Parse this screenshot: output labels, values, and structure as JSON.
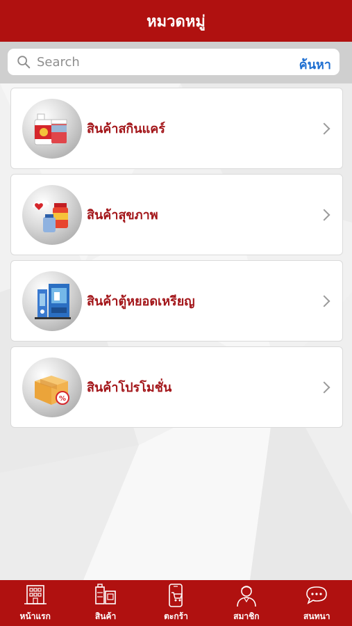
{
  "header": {
    "title": "หมวดหมู่"
  },
  "search": {
    "placeholder": "Search",
    "button_label": "ค้นหา"
  },
  "categories": [
    {
      "label": "สินค้าสกินแคร์",
      "icon": "skincare-icon"
    },
    {
      "label": "สินค้าสุขภาพ",
      "icon": "health-icon"
    },
    {
      "label": "สินค้าตู้หยอดเหรียญ",
      "icon": "vending-machine-icon"
    },
    {
      "label": "สินค้าโปรโมชั่น",
      "icon": "promotion-box-icon"
    }
  ],
  "tabbar": {
    "items": [
      {
        "label": "หน้าแรก",
        "icon": "home-building-icon"
      },
      {
        "label": "สินค้า",
        "icon": "products-icon"
      },
      {
        "label": "ตะกร้า",
        "icon": "cart-phone-icon"
      },
      {
        "label": "สมาชิก",
        "icon": "member-icon"
      },
      {
        "label": "สนทนา",
        "icon": "chat-icon"
      }
    ]
  },
  "colors": {
    "brand_red": "#b01110",
    "label_red": "#a3161a",
    "search_link_blue": "#1e6fd1"
  }
}
